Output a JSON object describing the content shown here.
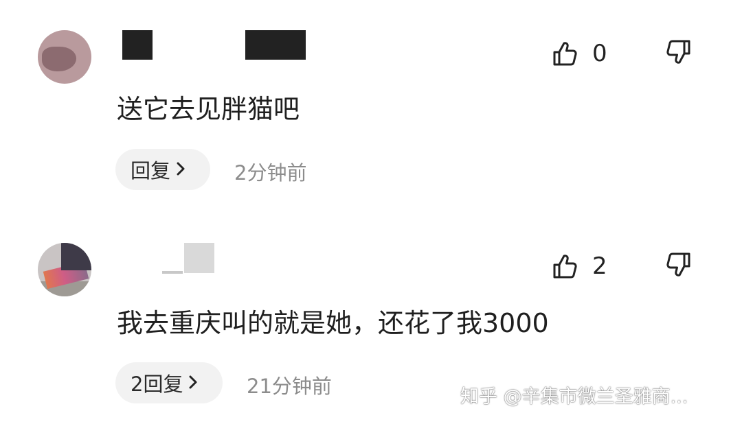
{
  "comments": [
    {
      "text": "送它去见胖猫吧",
      "like_count": "0",
      "reply_label": "回复",
      "time": "2分钟前"
    },
    {
      "text": "我去重庆叫的就是她，还花了我3000",
      "like_count": "2",
      "reply_label": "2回复",
      "time": "21分钟前"
    }
  ],
  "icons": {
    "like": "thumbs-up-icon",
    "dislike": "thumbs-down-icon",
    "reply_arrow": "chevron-right-icon"
  },
  "watermark": "知乎 @辛集市微兰圣雅商...",
  "colors": {
    "text": "#1f1f1f",
    "muted": "#8c8c8c",
    "pill_bg": "#f2f2f2"
  }
}
